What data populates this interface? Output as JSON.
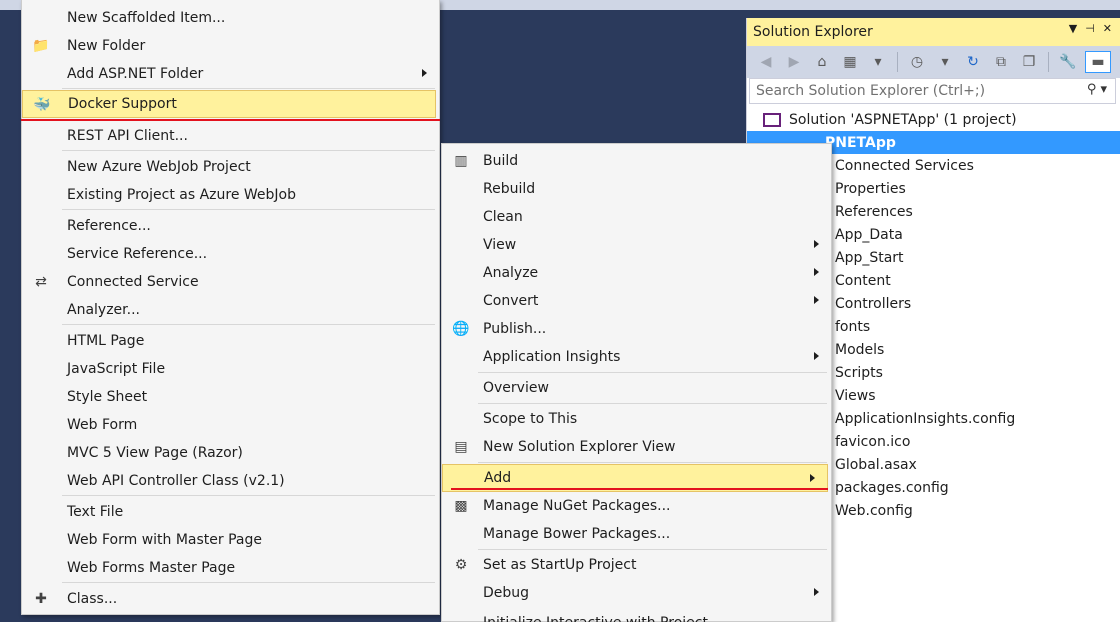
{
  "colors": {
    "accent": "#3399ff",
    "highlight": "#fff29d",
    "underline": "#e3121e",
    "background": "#2b3a5c"
  },
  "solution_explorer": {
    "title": "Solution Explorer",
    "search_placeholder": "Search Solution Explorer (Ctrl+;)",
    "solution_label": "Solution 'ASPNETApp' (1 project)",
    "project_label": "PNETApp",
    "items": [
      "Connected Services",
      "Properties",
      "References",
      "App_Data",
      "App_Start",
      "Content",
      "Controllers",
      "fonts",
      "Models",
      "Scripts",
      "Views",
      "ApplicationInsights.config",
      "favicon.ico",
      "Global.asax",
      "packages.config",
      "Web.config"
    ]
  },
  "add_submenu": {
    "items": [
      {
        "label": "New Scaffolded Item...",
        "icon": ""
      },
      {
        "label": "New Folder",
        "icon": "new-folder-icon"
      },
      {
        "label": "Add ASP.NET Folder",
        "icon": "",
        "submenu": true
      },
      {
        "label": "Docker Support",
        "icon": "docker-icon",
        "highlighted": true
      },
      {
        "label": "REST API Client...",
        "icon": ""
      },
      {
        "label": "New Azure WebJob Project",
        "icon": ""
      },
      {
        "label": "Existing Project as Azure WebJob",
        "icon": ""
      },
      {
        "label": "Reference...",
        "icon": ""
      },
      {
        "label": "Service Reference...",
        "icon": ""
      },
      {
        "label": "Connected Service",
        "icon": "connected-service-icon"
      },
      {
        "label": "Analyzer...",
        "icon": ""
      },
      {
        "label": "HTML Page",
        "icon": ""
      },
      {
        "label": "JavaScript File",
        "icon": ""
      },
      {
        "label": "Style Sheet",
        "icon": ""
      },
      {
        "label": "Web Form",
        "icon": ""
      },
      {
        "label": "MVC 5 View Page (Razor)",
        "icon": ""
      },
      {
        "label": "Web API Controller Class (v2.1)",
        "icon": ""
      },
      {
        "label": "Text File",
        "icon": ""
      },
      {
        "label": "Web Form with Master Page",
        "icon": ""
      },
      {
        "label": "Web Forms Master Page",
        "icon": ""
      },
      {
        "label": "Class...",
        "icon": "class-icon"
      }
    ]
  },
  "project_menu": {
    "items": [
      {
        "label": "Build",
        "icon": "build-icon"
      },
      {
        "label": "Rebuild",
        "icon": ""
      },
      {
        "label": "Clean",
        "icon": ""
      },
      {
        "label": "View",
        "icon": "",
        "submenu": true
      },
      {
        "label": "Analyze",
        "icon": "",
        "submenu": true
      },
      {
        "label": "Convert",
        "icon": "",
        "submenu": true
      },
      {
        "label": "Publish...",
        "icon": "publish-icon"
      },
      {
        "label": "Application Insights",
        "icon": "",
        "submenu": true
      },
      {
        "label": "Overview",
        "icon": ""
      },
      {
        "label": "Scope to This",
        "icon": ""
      },
      {
        "label": "New Solution Explorer View",
        "icon": "new-view-icon"
      },
      {
        "label": "Add",
        "icon": "",
        "submenu": true,
        "highlighted": true
      },
      {
        "label": "Manage NuGet Packages...",
        "icon": "nuget-icon"
      },
      {
        "label": "Manage Bower Packages...",
        "icon": ""
      },
      {
        "label": "Set as StartUp Project",
        "icon": "gear-icon"
      },
      {
        "label": "Debug",
        "icon": "",
        "submenu": true
      },
      {
        "label": "Initialize Interactive with Project",
        "icon": ""
      }
    ]
  }
}
